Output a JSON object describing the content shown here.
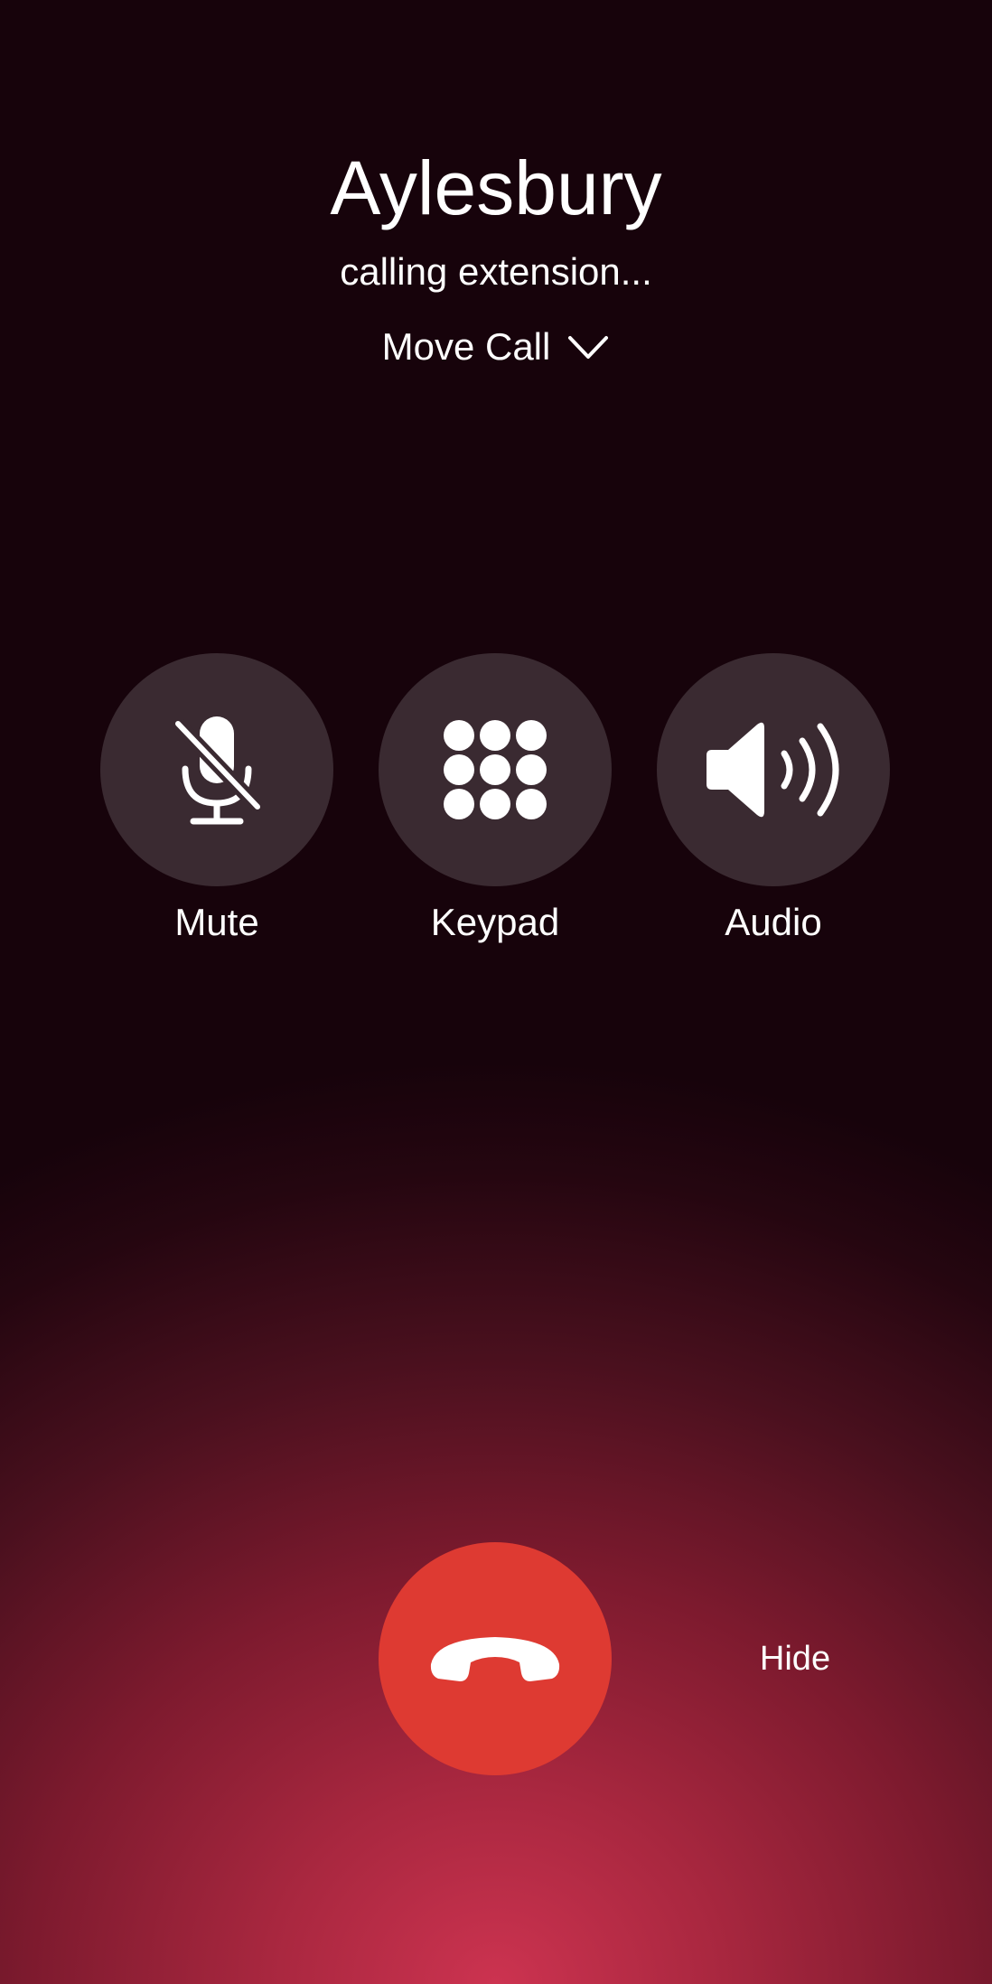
{
  "call": {
    "caller_name": "Aylesbury",
    "status": "calling extension...",
    "move_call_label": "Move Call"
  },
  "controls": {
    "mute": {
      "label": "Mute",
      "icon": "mic-slash-icon"
    },
    "keypad": {
      "label": "Keypad",
      "icon": "keypad-icon"
    },
    "audio": {
      "label": "Audio",
      "icon": "speaker-wave-icon"
    }
  },
  "actions": {
    "end_call_icon": "phone-hangup-icon",
    "hide_label": "Hide"
  },
  "colors": {
    "background_top": "#17030b",
    "background_glow": "#cc3350",
    "control_circle": "#3a2a31",
    "end_call": "#de3a32",
    "text": "#ffffff"
  }
}
